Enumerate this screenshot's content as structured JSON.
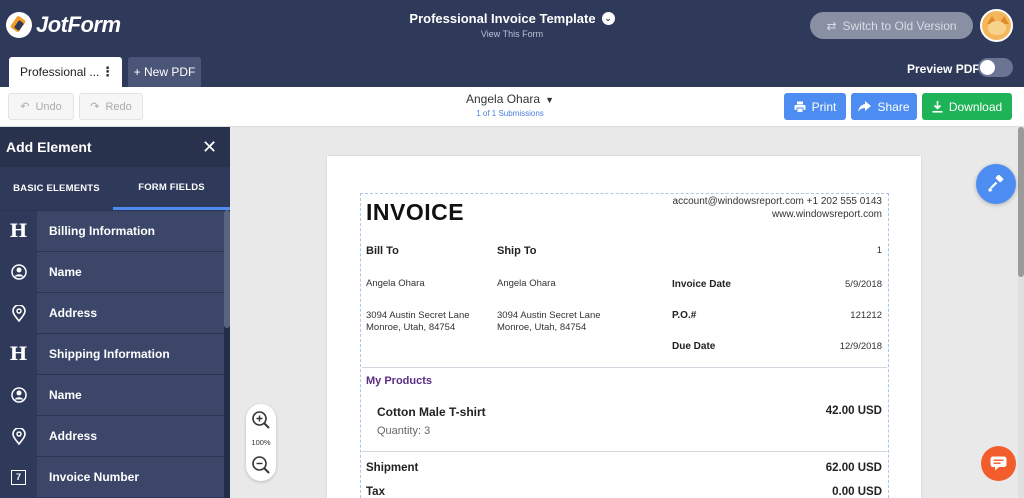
{
  "header": {
    "brand": "JotForm",
    "form_title": "Professional Invoice Template",
    "view_form": "View This Form",
    "switch_label": "Switch to Old Version"
  },
  "tabs": {
    "document_tab": "Professional ...",
    "new_pdf": "+ New PDF",
    "preview_label": "Preview PDF",
    "preview_on": false
  },
  "toolbar": {
    "undo": "Undo",
    "redo": "Redo",
    "submission_name": "Angela Ohara",
    "submission_count": "1 of 1 Submissions",
    "print": "Print",
    "share": "Share",
    "download": "Download"
  },
  "sidebar": {
    "title": "Add Element",
    "tabs": [
      "BASIC ELEMENTS",
      "FORM FIELDS"
    ],
    "active_tab": "FORM FIELDS",
    "items": [
      {
        "icon": "heading-icon",
        "glyph": "H",
        "label": "Billing Information"
      },
      {
        "icon": "user-icon",
        "label": "Name"
      },
      {
        "icon": "location-pin-icon",
        "label": "Address"
      },
      {
        "icon": "heading-icon",
        "glyph": "H",
        "label": "Shipping Information"
      },
      {
        "icon": "user-icon",
        "label": "Name"
      },
      {
        "icon": "location-pin-icon",
        "label": "Address"
      },
      {
        "icon": "number-icon",
        "glyph": "7",
        "label": "Invoice Number"
      }
    ]
  },
  "invoice": {
    "title": "INVOICE",
    "email_phone": "account@windowsreport.com +1 202 555 0143",
    "website": "www.windowsreport.com",
    "bill_to_label": "Bill To",
    "ship_to_label": "Ship To",
    "invoice_number": "1",
    "bill_name": "Angela Ohara",
    "ship_name": "Angela Ohara",
    "bill_address_1": "3094 Austin Secret Lane",
    "bill_address_2": "Monroe, Utah, 84754",
    "ship_address_1": "3094 Austin Secret Lane",
    "ship_address_2": "Monroe, Utah, 84754",
    "invoice_date_label": "Invoice Date",
    "invoice_date": "5/9/2018",
    "po_label": "P.O.#",
    "po": "121212",
    "due_date_label": "Due Date",
    "due_date": "12/9/2018",
    "products_label": "My Products",
    "product_name": "Cotton Male T-shirt",
    "product_qty": "Quantity: 3",
    "product_price": "42.00 USD",
    "shipment_label": "Shipment",
    "shipment_amount": "62.00 USD",
    "tax_label": "Tax",
    "tax_amount": "0.00 USD"
  },
  "zoom": {
    "level": "100%"
  },
  "colors": {
    "header": "#2f3a5a",
    "accent": "#4d8df1",
    "download": "#1db356",
    "chat": "#f25d2b",
    "products": "#5b2d83"
  }
}
